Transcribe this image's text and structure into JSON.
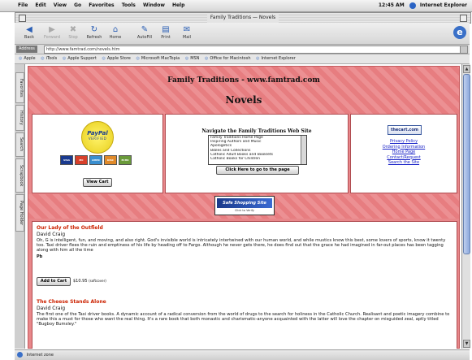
{
  "menubar": {
    "apple": "",
    "menus": [
      "File",
      "Edit",
      "View",
      "Go",
      "Favorites",
      "Tools",
      "Window",
      "Help"
    ],
    "clock": "12:45 AM",
    "app_name": "Internet Explorer"
  },
  "window": {
    "title": "Family Traditions — Novels"
  },
  "toolbar": {
    "buttons": [
      {
        "label": "Back",
        "icon": "back-arrow-icon"
      },
      {
        "label": "Forward",
        "icon": "forward-arrow-icon"
      },
      {
        "label": "Stop",
        "icon": "stop-icon"
      },
      {
        "label": "Refresh",
        "icon": "refresh-icon"
      },
      {
        "label": "Home",
        "icon": "home-icon"
      },
      {
        "label": "AutoFill",
        "icon": "autofill-icon"
      },
      {
        "label": "Print",
        "icon": "print-icon"
      },
      {
        "label": "Mail",
        "icon": "mail-icon"
      }
    ]
  },
  "address": {
    "label": "Address",
    "url": "http://www.famtrad.com/novels.htm"
  },
  "favorites": {
    "items": [
      "Apple",
      "iTools",
      "Apple Support",
      "Apple Store",
      "Microsoft MacTopia",
      "MSN",
      "Office for Macintosh",
      "Internet Explorer"
    ]
  },
  "sidetabs": [
    "Favorites",
    "History",
    "Search",
    "Scrapbook",
    "Page Holder"
  ],
  "page": {
    "site_title": "Family Traditions - www.famtrad.com",
    "heading": "Novels",
    "paypal": {
      "logo": "PayPal",
      "verified": "VERIFIED"
    },
    "cards": [
      {
        "name": "VISA",
        "color": "#1a3a8f"
      },
      {
        "name": "MC",
        "color": "#d8402a"
      },
      {
        "name": "AMEX",
        "color": "#3a8fd0"
      },
      {
        "name": "DISC",
        "color": "#e08a2a"
      },
      {
        "name": "ECHK",
        "color": "#6a9a3a"
      }
    ],
    "view_cart": "View Cart",
    "nav": {
      "title": "Navigate the Family Traditions Web Site",
      "options": [
        "Family Traditions Home Page",
        "Inspiring Authors and Music",
        "Apologetics",
        "Bibles and Collections",
        "Catholic Adult Books and Booklets",
        "Catholic Books for Children"
      ],
      "button": "Click Here to go to the page"
    },
    "thecart": "thecart.com",
    "links": [
      "Privacy Policy",
      "Ordering Information",
      "Home Page",
      "Contact/Request",
      "Search the Site"
    ],
    "banner": {
      "text": "Safe Shopping Site",
      "sub": "Click to Verify"
    },
    "books": [
      {
        "title": "Our Lady of the Outfield",
        "author": "David Craig",
        "desc": "Oh, G is intelligent, fun, and moving, and also right. God's invisible world is intricately intertwined with our human world, and while mustics know this best, some lovers of sports, know it twenty too. Taxi driver flees the ruin and emptiness of his life by heading off to Fargo. Although he never gets there, he does find out that the grace he had imagined in far-out places has been tagging along with him all the time",
        "fb": "Pb",
        "add_label": "Add to Cart",
        "price": "$10.95",
        "price_note": "(softcover)"
      },
      {
        "title": "The Cheese Stands Alone",
        "author": "David Craig",
        "desc": "The first one of the Taxi driver books. A dynamic account of a radical conversion from the world of drugs to the search for holiness in the Catholic Church. Realisant and poetic imagery combine to make this a must for those who want the real thing. It's a rare book that both monastic and charismatic-anyone acquainted with the latter will love the chapter on misguided zeal, aptly titled \"Bugboy Bumsley.\""
      }
    ]
  },
  "status": {
    "text": "Internet zone"
  }
}
